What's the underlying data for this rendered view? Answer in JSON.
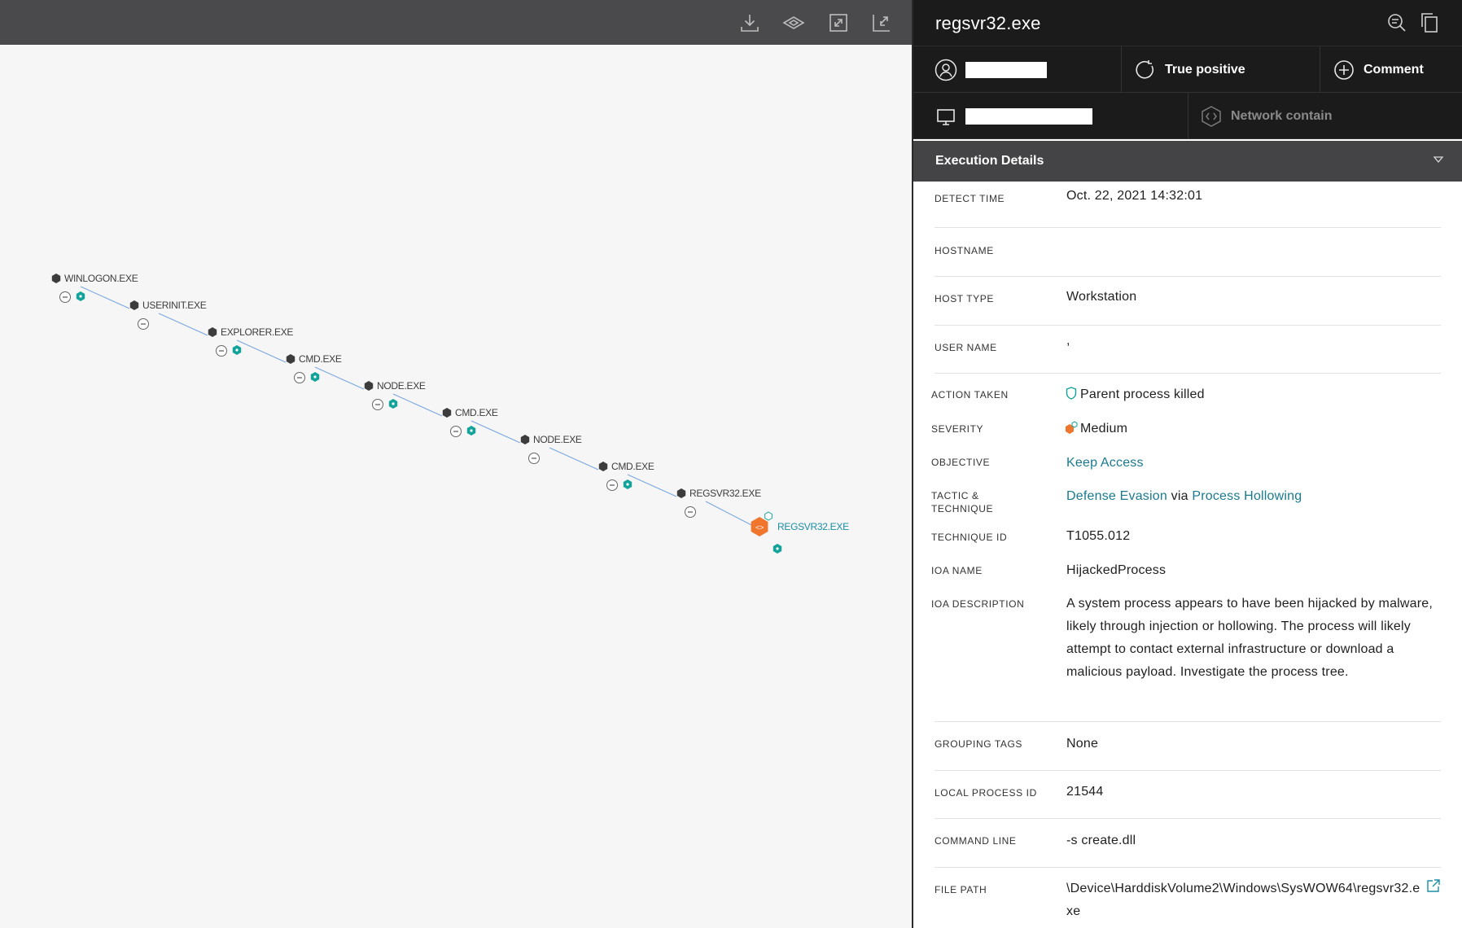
{
  "graph_toolbar": {
    "buttons": [
      {
        "name": "download-icon"
      },
      {
        "name": "layers-icon"
      },
      {
        "name": "expand-icon"
      },
      {
        "name": "collapse-icon"
      }
    ]
  },
  "process_tree": [
    {
      "label": "WINLOGON.EXE",
      "badges": [
        "minus",
        "hex"
      ]
    },
    {
      "label": "USERINIT.EXE",
      "badges": [
        "minus"
      ]
    },
    {
      "label": "EXPLORER.EXE",
      "badges": [
        "minus",
        "hex"
      ]
    },
    {
      "label": "CMD.EXE",
      "badges": [
        "minus",
        "hex"
      ]
    },
    {
      "label": "NODE.EXE",
      "badges": [
        "minus",
        "hex"
      ]
    },
    {
      "label": "CMD.EXE",
      "badges": [
        "minus",
        "hex"
      ]
    },
    {
      "label": "NODE.EXE",
      "badges": [
        "minus"
      ]
    },
    {
      "label": "CMD.EXE",
      "badges": [
        "minus",
        "hex"
      ]
    },
    {
      "label": "REGSVR32.EXE",
      "badges": [
        "minus"
      ]
    },
    {
      "label": "REGSVR32.EXE",
      "badges": [
        "hex"
      ],
      "highlighted": true
    }
  ],
  "colors": {
    "accent_teal": "#1b8ea3",
    "node_dark": "#3c3c3c",
    "badge_teal": "#14a39a",
    "alert_orange": "#f0752d",
    "edge_blue": "#7aa7e0"
  },
  "detail": {
    "title": "regsvr32.exe",
    "header_icons": [
      "search-list-icon",
      "copy-icon"
    ],
    "actions_row1": [
      {
        "icon": "user-icon",
        "label": "",
        "redacted": true
      },
      {
        "icon": "refresh-icon",
        "label": "True positive"
      },
      {
        "icon": "plus-circle-icon",
        "label": "Comment"
      }
    ],
    "actions_row2": [
      {
        "icon": "monitor-icon",
        "label": "",
        "redacted": true
      },
      {
        "icon": "network-contain-icon",
        "label": "Network contain",
        "disabled": true
      }
    ],
    "section_title": "Execution Details",
    "fields": {
      "detect_time": {
        "label": "DETECT TIME",
        "value": "Oct. 22, 2021 14:32:01"
      },
      "hostname": {
        "label": "HOSTNAME",
        "value": ""
      },
      "host_type": {
        "label": "HOST TYPE",
        "value": "Workstation"
      },
      "user_name": {
        "label": "USER NAME",
        "value": ","
      },
      "action_taken": {
        "label": "ACTION TAKEN",
        "value": "Parent process killed"
      },
      "severity": {
        "label": "SEVERITY",
        "value": "Medium"
      },
      "objective": {
        "label": "OBJECTIVE",
        "value": "Keep Access"
      },
      "tactic": {
        "label": "TACTIC & TECHNIQUE",
        "tactic": "Defense Evasion",
        "via": "via",
        "technique": "Process Hollowing"
      },
      "technique_id": {
        "label": "TECHNIQUE ID",
        "value": "T1055.012"
      },
      "ioa_name": {
        "label": "IOA NAME",
        "value": "HijackedProcess"
      },
      "ioa_description": {
        "label": "IOA DESCRIPTION",
        "value": "A system process appears to have been hijacked by malware, likely through injection or hollowing. The process will likely attempt to contact external infrastructure or download a malicious payload. Investigate the process tree."
      },
      "grouping_tags": {
        "label": "GROUPING TAGS",
        "value": "None"
      },
      "local_pid": {
        "label": "LOCAL PROCESS ID",
        "value": "21544"
      },
      "command_line": {
        "label": "COMMAND LINE",
        "value": "-s create.dll"
      },
      "file_path": {
        "label": "FILE PATH",
        "value": "\\Device\\HarddiskVolume2\\Windows\\SysWOW64\\regsvr32.exe"
      }
    }
  }
}
